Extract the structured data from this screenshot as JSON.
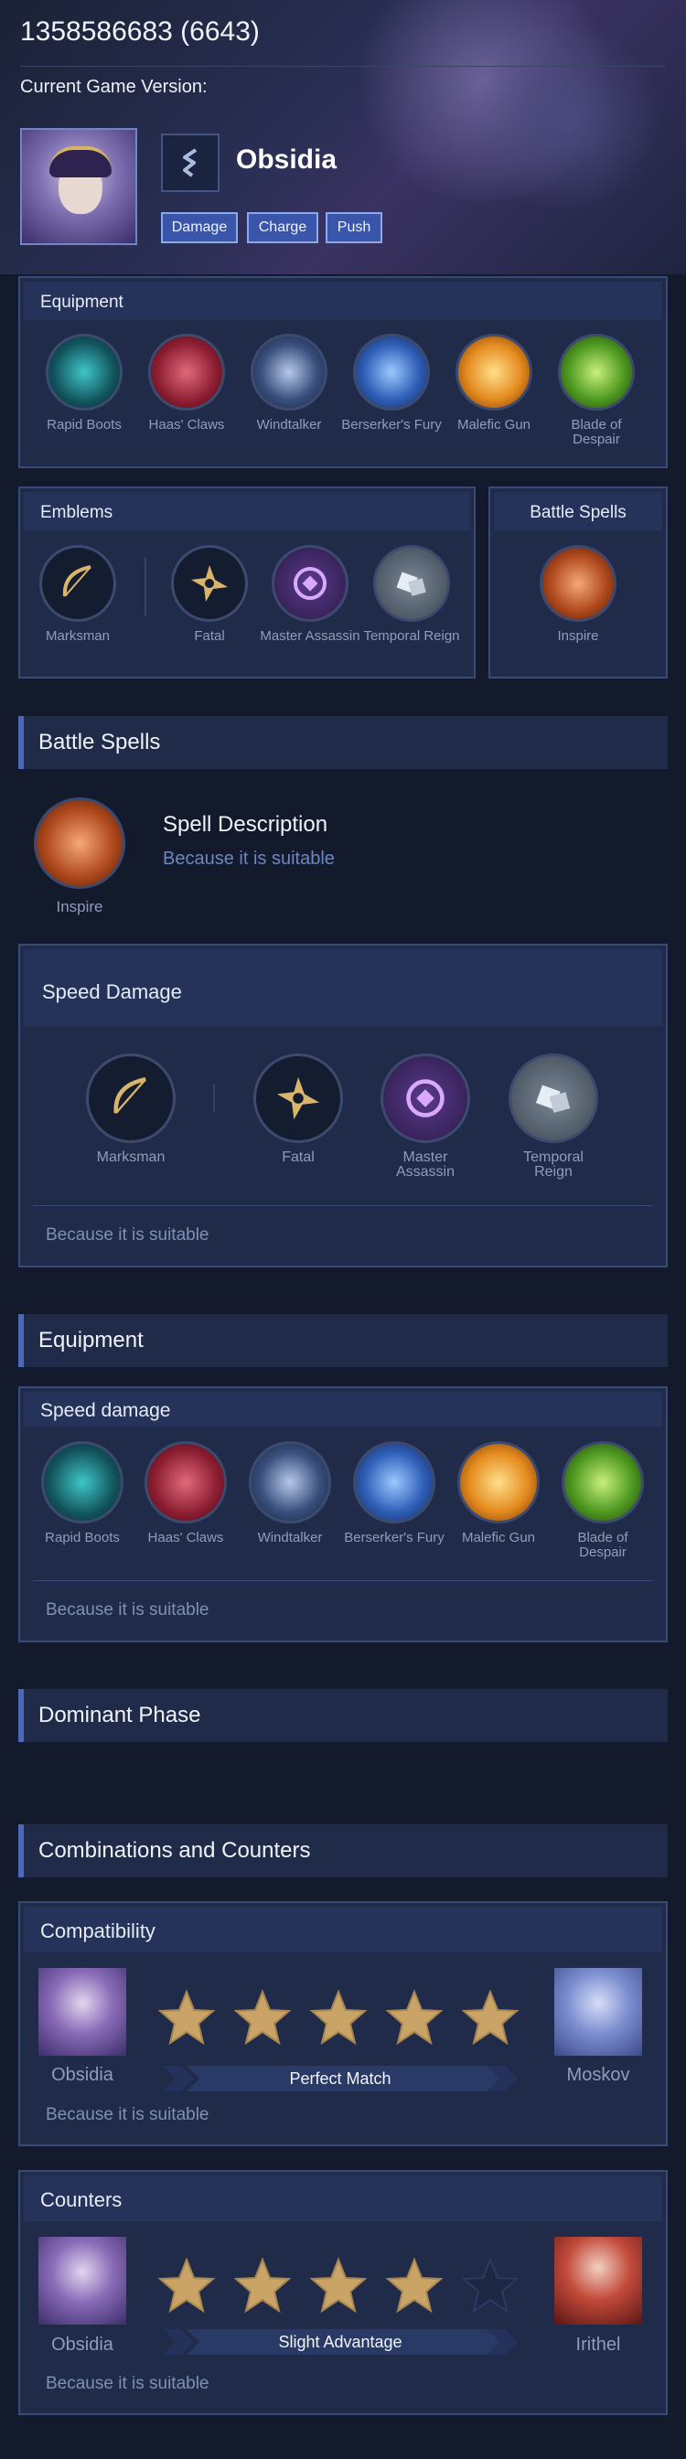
{
  "header": {
    "title": "1358586683 (6643)",
    "version_label": "Current Game Version:",
    "hero_name": "Obsidia",
    "tags": [
      "Damage",
      "Charge",
      "Push"
    ]
  },
  "equipment_panel": {
    "title": "Equipment",
    "items": [
      "Rapid Boots",
      "Haas' Claws",
      "Windtalker",
      "Berserker's Fury",
      "Malefic Gun",
      "Blade of Despair"
    ]
  },
  "emblems_panel": {
    "title": "Emblems",
    "items": [
      "Marksman",
      "Fatal",
      "Master Assassin",
      "Temporal Reign"
    ]
  },
  "battle_spells_panel": {
    "title": "Battle Spells",
    "spell": "Inspire"
  },
  "battle_spells_section": {
    "title": "Battle Spells",
    "spell": "Inspire",
    "desc_title": "Spell Description",
    "desc_text": "Because it is suitable"
  },
  "speed_damage_emblems": {
    "title": "Speed Damage",
    "items": [
      "Marksman",
      "Fatal",
      "Master Assassin",
      "Temporal Reign"
    ],
    "reason": "Because it is suitable"
  },
  "equipment_section": {
    "title": "Equipment",
    "subtitle": "Speed damage",
    "items": [
      "Rapid Boots",
      "Haas' Claws",
      "Windtalker",
      "Berserker's Fury",
      "Malefic Gun",
      "Blade of Despair"
    ],
    "reason": "Because it is suitable"
  },
  "dominant_phase": {
    "title": "Dominant Phase"
  },
  "combinations": {
    "title": "Combinations and Counters",
    "compatibility": {
      "title": "Compatibility",
      "hero_left": "Obsidia",
      "hero_right": "Moskov",
      "rating": 5,
      "max_rating": 5,
      "label": "Perfect Match",
      "reason": "Because it is suitable"
    },
    "counters": {
      "title": "Counters",
      "hero_left": "Obsidia",
      "hero_right": "Irithel",
      "rating": 4,
      "max_rating": 5,
      "label": "Slight Advantage",
      "reason": "Because it is suitable"
    }
  },
  "colors": {
    "background": "#121a2c",
    "panel": "#1f2b48",
    "accent": "#4c68b8",
    "star_gold": "#c9a466",
    "muted_text": "#8f9cbc"
  }
}
